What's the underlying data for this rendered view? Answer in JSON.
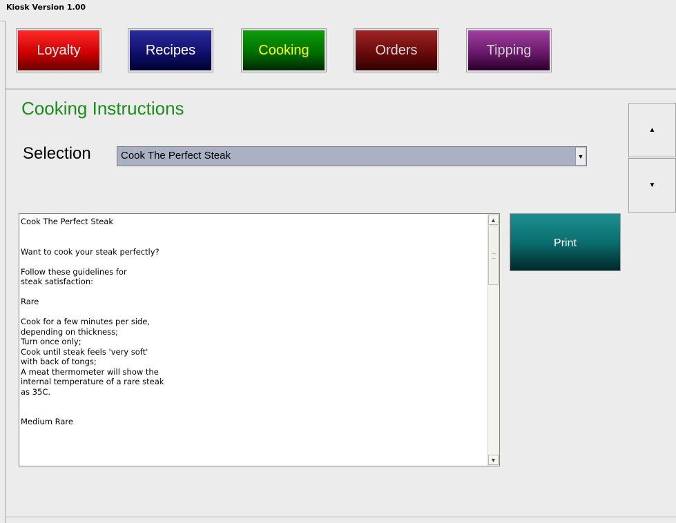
{
  "window": {
    "title": "Kiosk Version 1.00"
  },
  "nav": {
    "loyalty": "Loyalty",
    "recipes": "Recipes",
    "cooking": "Cooking",
    "orders": "Orders",
    "tipping": "Tipping"
  },
  "main": {
    "title": "Cooking Instructions",
    "selection_label": "Selection",
    "selection_value": "Cook The Perfect Steak",
    "instructions_text": "Cook The Perfect Steak\n\n\nWant to cook your steak perfectly?\n\nFollow these guidelines for\nsteak satisfaction:\n\nRare\n\nCook for a few minutes per side,\ndepending on thickness;\nTurn once only;\nCook until steak feels 'very soft'\nwith back of tongs;\nA meat thermometer will show the\ninternal temperature of a rare steak\nas 35C.\n\n\nMedium Rare",
    "print_label": "Print"
  },
  "icons": {
    "scroll_up": "up-arrow-icon",
    "scroll_down": "down-arrow-icon",
    "dropdown": "chevron-down-icon"
  },
  "colors": {
    "title_green": "#1a8c1a",
    "loyalty": "#d00000",
    "recipes": "#101070",
    "cooking": "#007000",
    "orders": "#6a0a0a",
    "tipping": "#6a1a6a",
    "print": "#0a6e6e"
  }
}
